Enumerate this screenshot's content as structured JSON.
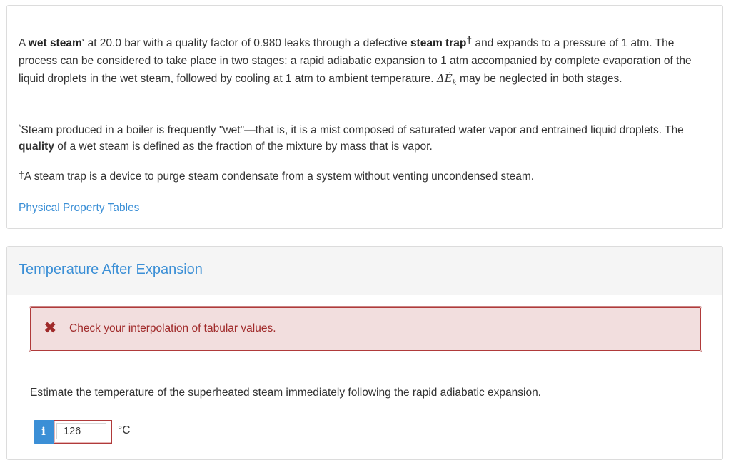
{
  "problem": {
    "seg1": "A ",
    "wet_steam": "wet steam",
    "star": "*",
    "seg2": " at 20.0 bar with a quality factor of 0.980 leaks through a defective ",
    "steam_trap": "steam trap",
    "dagger": "†",
    "seg3": " and expands to a pressure of 1 atm. The process can be considered to take place in two stages: a rapid adiabatic expansion to 1 atm accompanied by complete evaporation of the liquid droplets in the wet steam, followed by cooling at 1 atm to ambient temperature. ",
    "delta_ek": "ΔĖ",
    "delta_ek_sub": "k",
    "seg4": " may be neglected in both stages."
  },
  "footnotes": {
    "note1_star": "*",
    "note1_text_a": "Steam produced in a boiler is frequently \"wet\"—that is, it is a mist composed of saturated water vapor and entrained liquid droplets. The ",
    "note1_quality": "quality",
    "note1_text_b": " of a wet steam is defined as the fraction of the mixture by mass that is vapor.",
    "note2_dagger": "†",
    "note2_text": "A steam trap is a device to purge steam condensate from a system without venting uncondensed steam."
  },
  "links": {
    "property_tables": "Physical Property Tables"
  },
  "part": {
    "title": "Temperature After Expansion",
    "feedback_icon": "✖",
    "feedback_text": "Check your interpolation of tabular values.",
    "question": "Estimate the temperature of the superheated steam immediately following the rapid adiabatic expansion.",
    "info_label": "i",
    "answer_value": "126",
    "unit": "°C"
  },
  "colors": {
    "link": "#3b8fd6",
    "error_text": "#a02a2a",
    "error_bg": "#f2dede",
    "header_bg": "#f5f5f5"
  }
}
